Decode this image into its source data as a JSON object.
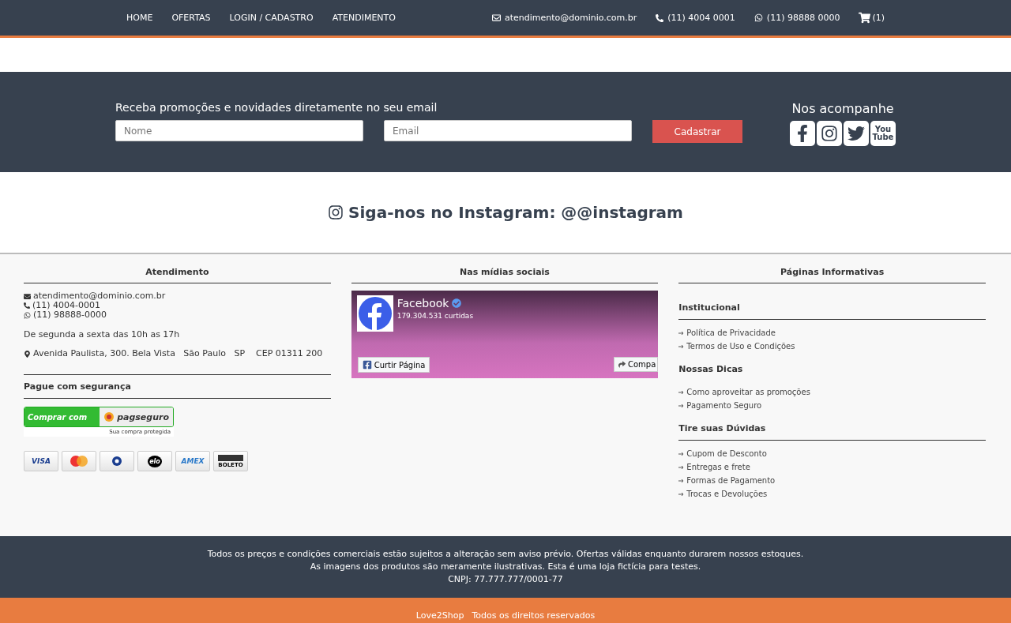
{
  "nav": {
    "links": [
      "HOME",
      "OFERTAS",
      "LOGIN / CADASTRO",
      "ATENDIMENTO"
    ],
    "email": "atendimento@dominio.com.br",
    "phone": "(11) 4004 0001",
    "whatsapp": "(11) 98888 0000",
    "cart": "(1)"
  },
  "newsletter": {
    "title": "Receba promoções e novidades diretamente no seu email",
    "name_placeholder": "Nome",
    "email_placeholder": "Email",
    "button": "Cadastrar",
    "follow_title": "Nos acompanhe",
    "social": [
      {
        "kind": "facebook"
      },
      {
        "kind": "instagram"
      },
      {
        "kind": "twitter"
      },
      {
        "kind": "youtube",
        "label": [
          "You",
          "Tube"
        ]
      }
    ]
  },
  "instagram": {
    "title": "Siga-nos no Instagram: @@instagram"
  },
  "footer": {
    "contact": {
      "title": "Atendimento",
      "email": "atendimento@dominio.com.br",
      "phone": "(11) 4004-0001",
      "whatsapp": "(11) 98888-0000",
      "hours": "De segunda a sexta das 10h as 17h",
      "address": "Avenida Paulista, 300. Bela Vista   São Paulo   SP    CEP 01311 200",
      "pay_title": "Pague com segurança",
      "pagseguro": {
        "lead": "Comprar com",
        "brand": "pagseguro",
        "caption": "Sua compra protegida"
      },
      "cards": [
        {
          "kind": "visa",
          "label": "VISA"
        },
        {
          "kind": "mastercard"
        },
        {
          "kind": "diners"
        },
        {
          "kind": "elo",
          "label": "elo"
        },
        {
          "kind": "amex",
          "label": "AMEX"
        },
        {
          "kind": "boleto",
          "label": "BOLETO"
        }
      ]
    },
    "social": {
      "title": "Nas mídias sociais",
      "page_name": "Facebook",
      "likes": "179.304.531 curtidas",
      "like_button": "Curtir Página",
      "share_button": "Compa"
    },
    "pages": {
      "title": "Páginas Informativas",
      "groups": [
        {
          "title": "Institucional",
          "ruled": true,
          "links": [
            "Política de Privacidade",
            "Termos de Uso e Condições"
          ]
        },
        {
          "title": "Nossas Dicas",
          "ruled": false,
          "links": [
            "Como aproveitar as promoções",
            "Pagamento Seguro"
          ]
        },
        {
          "title": "Tire suas Dúvidas",
          "ruled": true,
          "links": [
            "Cupom de Desconto",
            "Entregas e frete",
            "Formas de Pagamento",
            "Trocas e Devoluções"
          ]
        }
      ]
    }
  },
  "legal": [
    "Todos os preços e condições comerciais estão sujeitos a alteração sem aviso prévio. Ofertas válidas enquanto durarem nossos estoques.",
    "As imagens dos produtos são meramente ilustrativas. Esta é uma loja fictícia para testes.",
    "CNPJ: 77.777.777/0001-77"
  ],
  "copyright": {
    "brand": "Love2Shop",
    "text": "Todos os direitos reservados"
  }
}
